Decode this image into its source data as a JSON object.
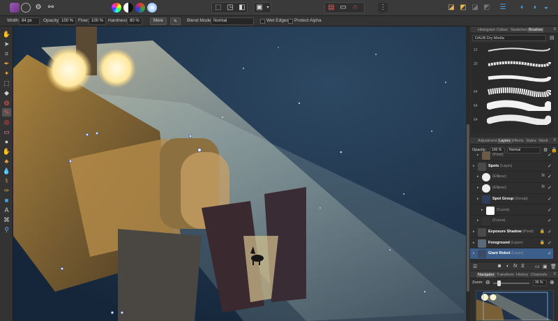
{
  "toolbar": {
    "more_label": "More"
  },
  "context": {
    "width_label": "Width:",
    "width_value": "84 px",
    "opacity_label": "Opacity:",
    "opacity_value": "100 %",
    "flow_label": "Flow:",
    "flow_value": "100 %",
    "hardness_label": "Hardness:",
    "hardness_value": "80 %",
    "more_label": "More",
    "blend_label": "Blend Mode:",
    "blend_value": "Normal",
    "wet_edges_label": "Wet Edges",
    "protect_alpha_label": "Protect Alpha"
  },
  "brushes_panel": {
    "tabs": [
      "Histogram",
      "Colour",
      "Swatches",
      "Brushes"
    ],
    "active_tab": "Brushes",
    "category": "DAUB Dry Media",
    "sizes": [
      "12",
      "20",
      "",
      "64",
      "64",
      "64"
    ]
  },
  "layers_panel": {
    "tabs": [
      "Adjustment",
      "Layers",
      "Effects",
      "Styles",
      "Stock"
    ],
    "active_tab": "Layers",
    "opacity_label": "Opacity:",
    "opacity_value": "100 %",
    "blend_value": "Normal",
    "layers": [
      {
        "name": "",
        "type": "(Pixel)",
        "indent": 1
      },
      {
        "name": "Spots",
        "type": "(Layer)",
        "indent": 0,
        "bold": true
      },
      {
        "name": "",
        "type": "(Ellipse)",
        "indent": 1,
        "fx": true
      },
      {
        "name": "",
        "type": "(Ellipse)",
        "indent": 1,
        "fx": true
      },
      {
        "name": "Spot Group",
        "type": "(Group)",
        "indent": 1,
        "bold": true
      },
      {
        "name": "",
        "type": "(Curve)",
        "indent": 2
      },
      {
        "name": "",
        "type": "(Curve)",
        "indent": 1
      },
      {
        "name": "Exposure Shadow",
        "type": "(Pixel)",
        "indent": 0,
        "bold": true,
        "lock": true
      },
      {
        "name": "Foreground",
        "type": "(Layer)",
        "indent": 0,
        "bold": true,
        "lock": true
      },
      {
        "name": "Giant Robot",
        "type": "(Layer)",
        "indent": 0,
        "bold": true,
        "selected": true
      }
    ]
  },
  "navigator_panel": {
    "tabs": [
      "Navigator",
      "Transform",
      "History",
      "Channels"
    ],
    "active_tab": "Navigator",
    "zoom_label": "Zoom:",
    "zoom_value": "36 %"
  },
  "colors": {
    "accent_selected": "#3b5f8a",
    "brand": "#8e44ad"
  }
}
